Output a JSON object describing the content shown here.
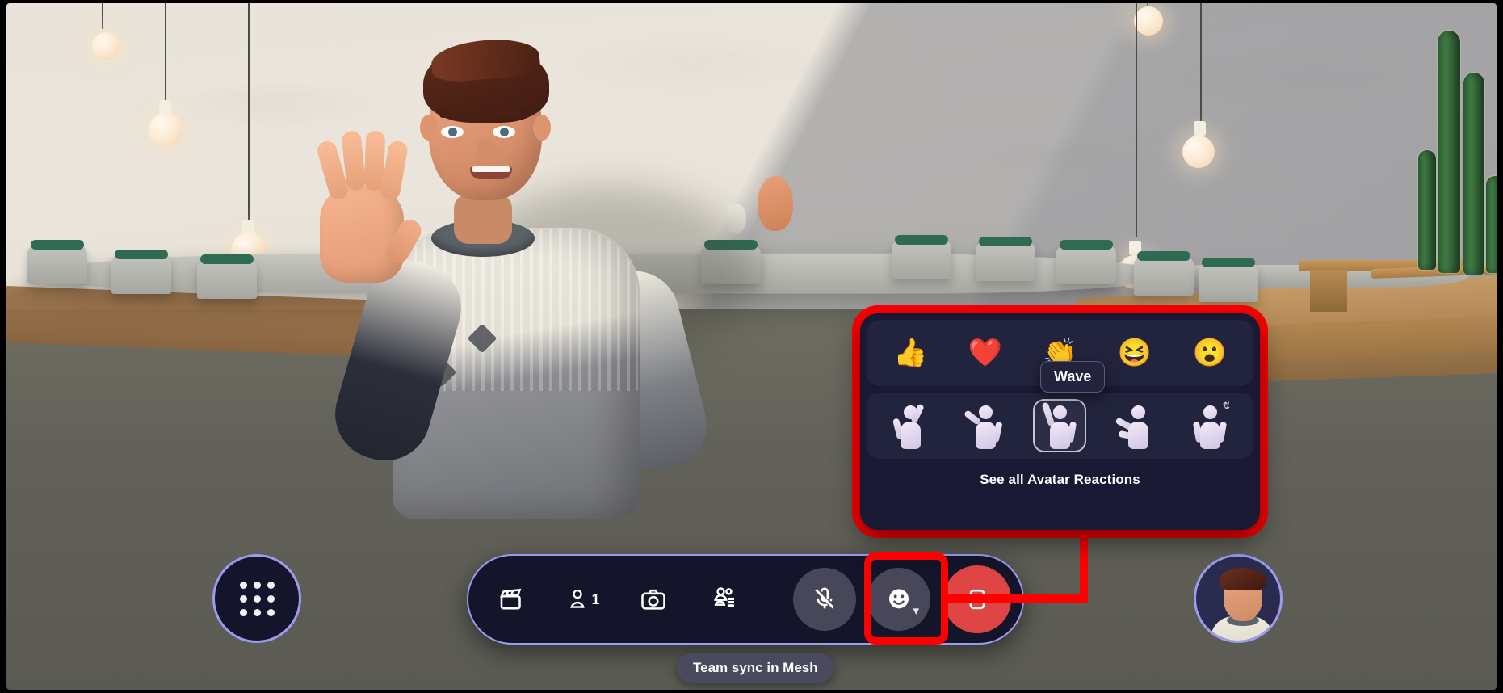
{
  "app": {
    "status_pill": "Team sync in Mesh",
    "accent_highlight": "#ff0000",
    "toolbar_border": "#9b9bef",
    "leave_color": "#e04545",
    "panel_bg": "#191933"
  },
  "reactions_panel": {
    "emoji_row": [
      {
        "name": "thumbs-up",
        "glyph": "👍",
        "label": "Thumbs up"
      },
      {
        "name": "heart",
        "glyph": "❤️",
        "label": "Heart"
      },
      {
        "name": "applause",
        "glyph": "👏",
        "label": "Applause"
      },
      {
        "name": "laugh",
        "glyph": "😆",
        "label": "Laugh"
      },
      {
        "name": "surprised",
        "glyph": "😮",
        "label": "Surprised"
      }
    ],
    "gesture_row": [
      {
        "name": "celebrate",
        "label": "Celebrate",
        "selected": false
      },
      {
        "name": "salute",
        "label": "Salute",
        "selected": false
      },
      {
        "name": "wave",
        "label": "Wave",
        "selected": true
      },
      {
        "name": "clap",
        "label": "Clap",
        "selected": false
      },
      {
        "name": "jump",
        "label": "Jump",
        "selected": false
      }
    ],
    "see_all_label": "See all Avatar Reactions",
    "hover_tooltip": "Wave"
  },
  "toolbar": {
    "items": [
      {
        "name": "stage-view",
        "icon": "clapperboard-icon",
        "label": "Stage view"
      },
      {
        "name": "participants",
        "icon": "people-icon",
        "label": "People",
        "count": "1"
      },
      {
        "name": "camera",
        "icon": "camera-icon",
        "label": "Camera"
      },
      {
        "name": "chat",
        "icon": "roster-icon",
        "label": "Chat"
      }
    ],
    "mic": {
      "name": "microphone",
      "icon": "mic-off-icon",
      "label": "Unmute",
      "muted": true
    },
    "reactions": {
      "name": "reactions",
      "icon": "smiley-icon",
      "label": "Reactions",
      "expanded": true
    },
    "leave": {
      "name": "leave",
      "icon": "leave-icon",
      "label": "Leave"
    }
  },
  "app_launcher": {
    "name": "app-launcher",
    "label": "Apps"
  },
  "self_avatar": {
    "name": "self-avatar",
    "label": "Your avatar"
  }
}
